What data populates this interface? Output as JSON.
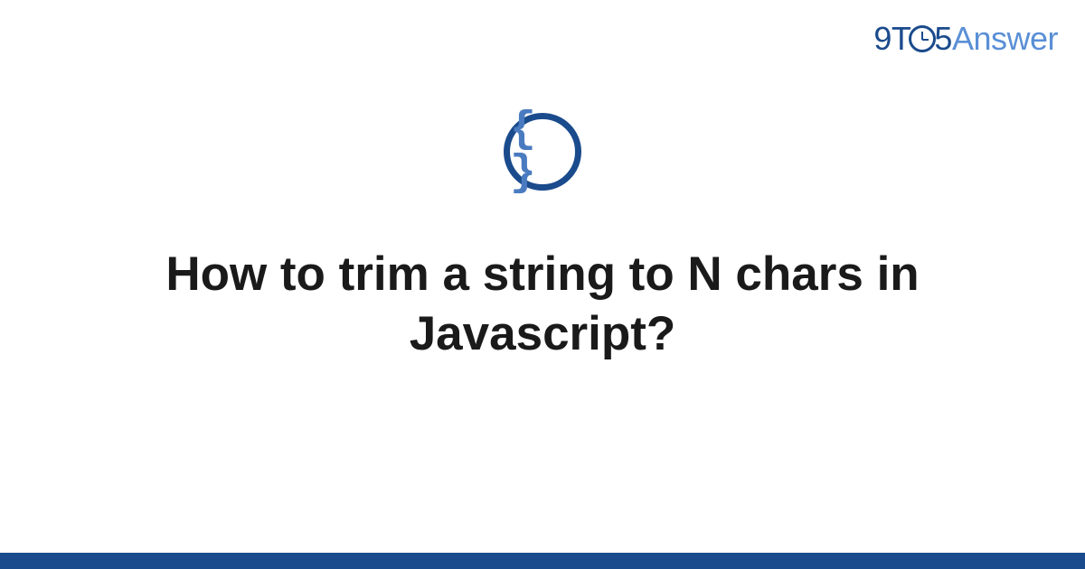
{
  "logo": {
    "part1": "9T",
    "part2": "5",
    "part3": "Answer"
  },
  "icon": {
    "symbol": "{ }",
    "name": "code-braces"
  },
  "title": "How to trim a string to N chars in Javascript?",
  "colors": {
    "primary": "#1a4b8c",
    "secondary": "#5a8fd6",
    "braces": "#4a7bc0"
  }
}
